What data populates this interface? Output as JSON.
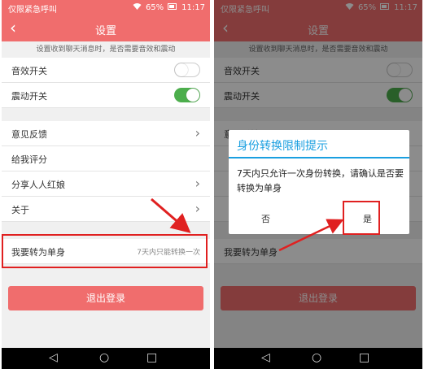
{
  "status": {
    "carrier": "仅限紧急呼叫",
    "battery": "65%",
    "time": "11:17"
  },
  "header": {
    "title": "设置",
    "back_icon": "‹"
  },
  "notice": "设置收到聊天消息时，是否需要音效和震动",
  "toggles": [
    {
      "label": "音效开关",
      "state": "off"
    },
    {
      "label": "震动开关",
      "state": "on"
    }
  ],
  "menu": [
    {
      "label": "意见反馈",
      "chevron": "›"
    },
    {
      "label": "给我评分",
      "chevron": ""
    },
    {
      "label": "分享人人红娘",
      "chevron": "›"
    },
    {
      "label": "关于",
      "chevron": "›"
    }
  ],
  "single_row": {
    "label": "我要转为单身",
    "hint": "7天内只能转换一次"
  },
  "logout_label": "退出登录",
  "dialog": {
    "title": "身份转换限制提示",
    "message": "7天内只允许一次身份转换，请确认是否要转换为单身",
    "no_label": "否",
    "yes_label": "是"
  },
  "nav": {
    "back": "◁",
    "home": "○",
    "recent": "□"
  },
  "colors": {
    "accent": "#f06d6d",
    "dialog_title": "#1a9fe0",
    "highlight": "#e02020",
    "toggle_on": "#4cae4c"
  }
}
